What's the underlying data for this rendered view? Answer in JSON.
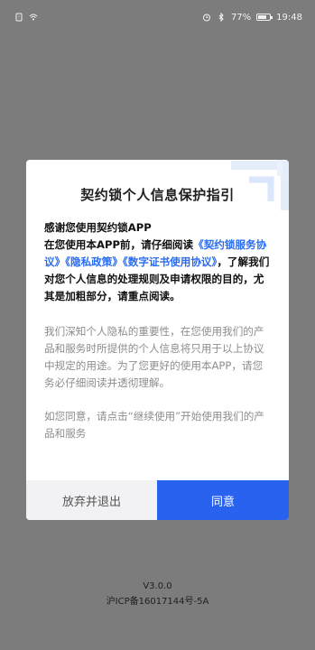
{
  "status_bar": {
    "battery": "77%",
    "time": "19:48",
    "battery_level": 0.77
  },
  "dialog": {
    "title": "契约锁个人信息保护指引",
    "greeting": "感谢您使用契约锁APP",
    "intro_prefix": "在您使用本APP前，请仔细阅读",
    "link_service": "《契约锁服务协议》",
    "link_privacy": "《隐私政策》",
    "link_cert": "《数字证书使用协议》",
    "intro_suffix": "，了解我们对您个人信息的处理规则及申请权限的目的，尤其是加粗部分，请重点阅读。",
    "paragraph_privacy": "我们深知个人隐私的重要性，在您使用我们的产品和服务时所提供的个人信息将只用于以上协议中规定的用途。为了您更好的使用本APP，请您务必仔细阅读并透彻理解。",
    "paragraph_consent": "如您同意，请点击“继续使用”开始使用我们的产品和服务",
    "cancel_label": "放弃并退出",
    "agree_label": "同意"
  },
  "footer": {
    "version": "V3.0.0",
    "icp": "沪ICP备16017144号-5A"
  },
  "colors": {
    "accent": "#2962ef",
    "link": "#2a6cf0",
    "overlay": "#7c7c7c"
  }
}
